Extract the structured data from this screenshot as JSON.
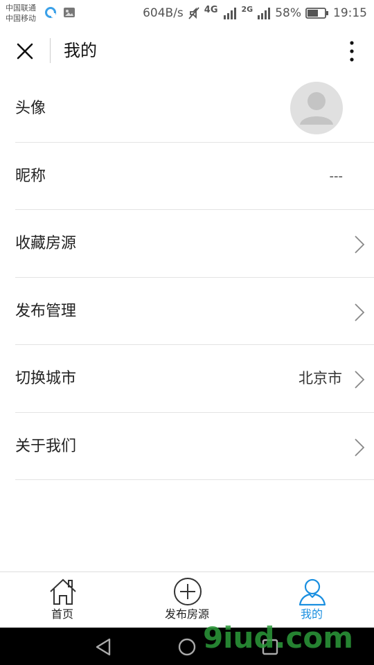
{
  "statusbar": {
    "carrier_1": "中国联通",
    "carrier_2": "中国移动",
    "speed": "604B/s",
    "network_1": "4G",
    "network_2": "2G",
    "battery": "58%",
    "time": "19:15"
  },
  "header": {
    "title": "我的"
  },
  "list": {
    "avatar_label": "头像",
    "nickname_label": "昵称",
    "nickname_value": "---",
    "favorites_label": "收藏房源",
    "publish_manage_label": "发布管理",
    "switch_city_label": "切换城市",
    "switch_city_value": "北京市",
    "about_label": "关于我们"
  },
  "tabs": [
    {
      "label": "首页",
      "icon": "home-icon",
      "active": false
    },
    {
      "label": "发布房源",
      "icon": "plus-circle-icon",
      "active": true
    },
    {
      "label": "我的",
      "icon": "user-icon",
      "active": true
    }
  ],
  "colors": {
    "accent": "#1a8fe0",
    "divider": "#e3e3e3",
    "avatar_bg": "#e0e0e0"
  },
  "watermark": "9iud.com"
}
